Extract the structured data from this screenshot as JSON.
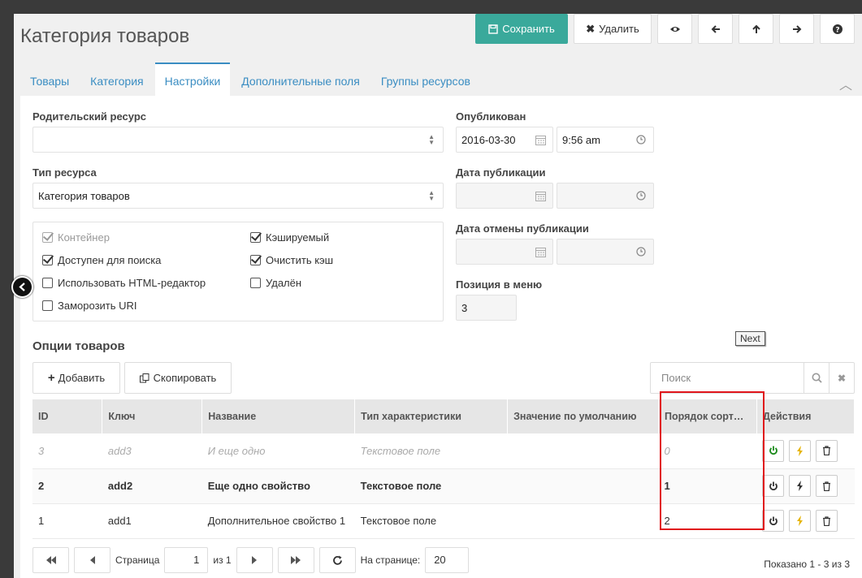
{
  "header": {
    "title": "Категория товаров"
  },
  "toolbar": {
    "save_label": "Сохранить",
    "delete_label": "Удалить"
  },
  "tabs": [
    {
      "label": "Товары"
    },
    {
      "label": "Категория"
    },
    {
      "label": "Настройки"
    },
    {
      "label": "Дополнительные поля"
    },
    {
      "label": "Группы ресурсов"
    }
  ],
  "form": {
    "parent_label": "Родительский ресурс",
    "parent_value": "",
    "type_label": "Тип ресурса",
    "type_value": "Категория товаров",
    "published_label": "Опубликован",
    "published_date": "2016-03-30",
    "published_time": "9:56 am",
    "pubdate_label": "Дата публикации",
    "unpubdate_label": "Дата отмены публикации",
    "menuindex_label": "Позиция в меню",
    "menuindex_value": "3"
  },
  "checkboxes": {
    "container": "Контейнер",
    "cacheable": "Кэшируемый",
    "searchable": "Доступен для поиска",
    "clear_cache": "Очистить кэш",
    "richtext": "Использовать HTML-редактор",
    "deleted": "Удалён",
    "freeze_uri": "Заморозить URI"
  },
  "options": {
    "title": "Опции товаров",
    "add_label": "Добавить",
    "copy_label": "Скопировать",
    "search_placeholder": "Поиск",
    "tooltip": "Next",
    "columns": [
      "ID",
      "Ключ",
      "Название",
      "Тип характеристики",
      "Значение по умолчанию",
      "Порядок сорт…",
      "Действия"
    ],
    "rows": [
      {
        "id": "3",
        "key": "add3",
        "name": "И еще одно",
        "type": "Текстовое поле",
        "default": "",
        "order": "0"
      },
      {
        "id": "2",
        "key": "add2",
        "name": "Еще одно свойство",
        "type": "Текстовое поле",
        "default": "",
        "order": "1"
      },
      {
        "id": "1",
        "key": "add1",
        "name": "Дополнительное свойство 1",
        "type": "Текстовое поле",
        "default": "",
        "order": "2"
      }
    ]
  },
  "pager": {
    "page_label": "Страница",
    "page_value": "1",
    "of_label": "из 1",
    "per_page_label": "На странице:",
    "per_page_value": "20",
    "shown_text": "Показано 1 - 3 из 3"
  },
  "colors": {
    "accent": "#3aa99b",
    "link": "#3a8dc2",
    "highlight": "#e0151b"
  }
}
